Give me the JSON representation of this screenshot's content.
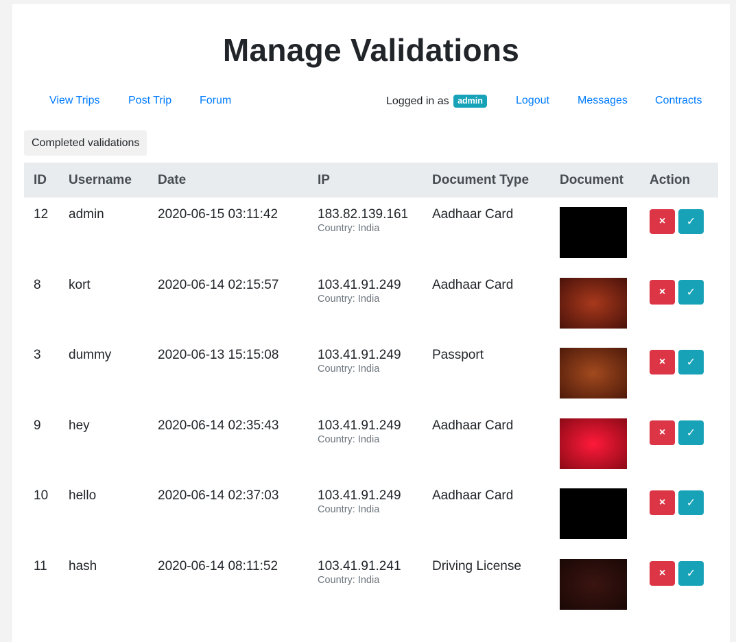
{
  "page": {
    "title": "Manage Validations"
  },
  "nav": {
    "view_trips": "View Trips",
    "post_trip": "Post Trip",
    "forum": "Forum",
    "logged_in_prefix": "Logged in as",
    "username": "admin",
    "logout": "Logout",
    "messages": "Messages",
    "contracts": "Contracts"
  },
  "completed_button": "Completed validations",
  "table": {
    "headers": [
      "ID",
      "Username",
      "Date",
      "IP",
      "Document Type",
      "Document",
      "Action"
    ],
    "rows": [
      {
        "id": "12",
        "username": "admin",
        "date": "2020-06-15 03:11:42",
        "ip": "183.82.139.161",
        "country": "Country: India",
        "doc_type": "Aadhaar Card",
        "doc_color_center": "#000000",
        "doc_color_edge": "#000000"
      },
      {
        "id": "8",
        "username": "kort",
        "date": "2020-06-14 02:15:57",
        "ip": "103.41.91.249",
        "country": "Country: India",
        "doc_type": "Aadhaar Card",
        "doc_color_center": "#a8391c",
        "doc_color_edge": "#4a120a"
      },
      {
        "id": "3",
        "username": "dummy",
        "date": "2020-06-13 15:15:08",
        "ip": "103.41.91.249",
        "country": "Country: India",
        "doc_type": "Passport",
        "doc_color_center": "#a24a1e",
        "doc_color_edge": "#4e1a0a"
      },
      {
        "id": "9",
        "username": "hey",
        "date": "2020-06-14 02:35:43",
        "ip": "103.41.91.249",
        "country": "Country: India",
        "doc_type": "Aadhaar Card",
        "doc_color_center": "#ff1a3a",
        "doc_color_edge": "#8a0a16"
      },
      {
        "id": "10",
        "username": "hello",
        "date": "2020-06-14 02:37:03",
        "ip": "103.41.91.249",
        "country": "Country: India",
        "doc_type": "Aadhaar Card",
        "doc_color_center": "#000000",
        "doc_color_edge": "#000000"
      },
      {
        "id": "11",
        "username": "hash",
        "date": "2020-06-14 08:11:52",
        "ip": "103.41.91.241",
        "country": "Country: India",
        "doc_type": "Driving License",
        "doc_color_center": "#3a1410",
        "doc_color_edge": "#1a0806"
      }
    ]
  },
  "actions": {
    "reject_glyph": "×",
    "approve_glyph": "✓"
  },
  "colors": {
    "link": "#007bff",
    "badge": "#17a2b8",
    "reject": "#dc3545",
    "approve": "#17a2b8",
    "header_bg": "#e9ecef"
  }
}
